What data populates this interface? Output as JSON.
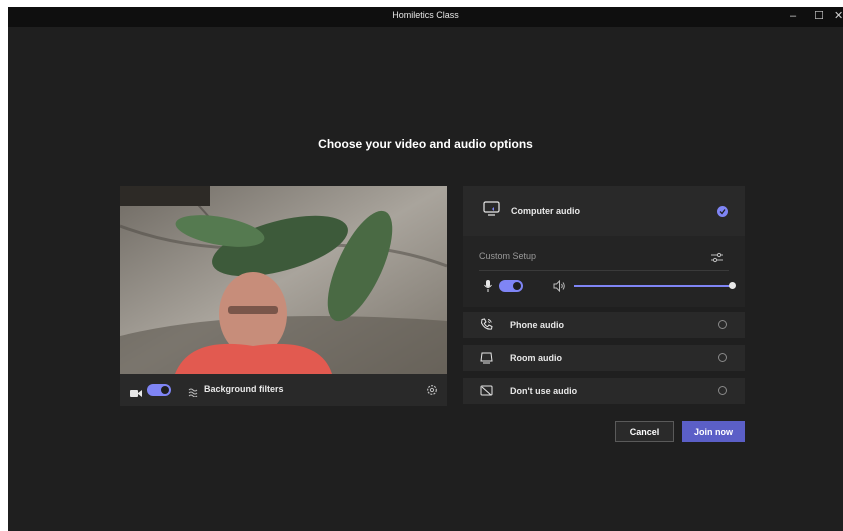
{
  "window": {
    "title": "Homiletics Class",
    "controls": {
      "minimize": "–",
      "maximize": "☐",
      "close": "✕"
    }
  },
  "heading": "Choose your video and audio options",
  "video": {
    "camera_icon": "video-camera-icon",
    "camera_on": true,
    "background_filters_label": "Background filters",
    "settings_icon": "gear-icon"
  },
  "audio": {
    "computer_audio": {
      "label": "Computer audio",
      "selected": true
    },
    "custom_setup": {
      "label": "Custom Setup",
      "mic_on": true,
      "speaker_volume": 1.0
    },
    "options": [
      {
        "label": "Phone audio",
        "icon": "phone-icon",
        "selected": false
      },
      {
        "label": "Room audio",
        "icon": "room-device-icon",
        "selected": false
      },
      {
        "label": "Don't use audio",
        "icon": "no-audio-icon",
        "selected": false
      }
    ]
  },
  "buttons": {
    "cancel": "Cancel",
    "join": "Join now"
  },
  "colors": {
    "accent": "#7f85f5",
    "join_button": "#5b5fc7",
    "background": "#1f1f1f"
  }
}
